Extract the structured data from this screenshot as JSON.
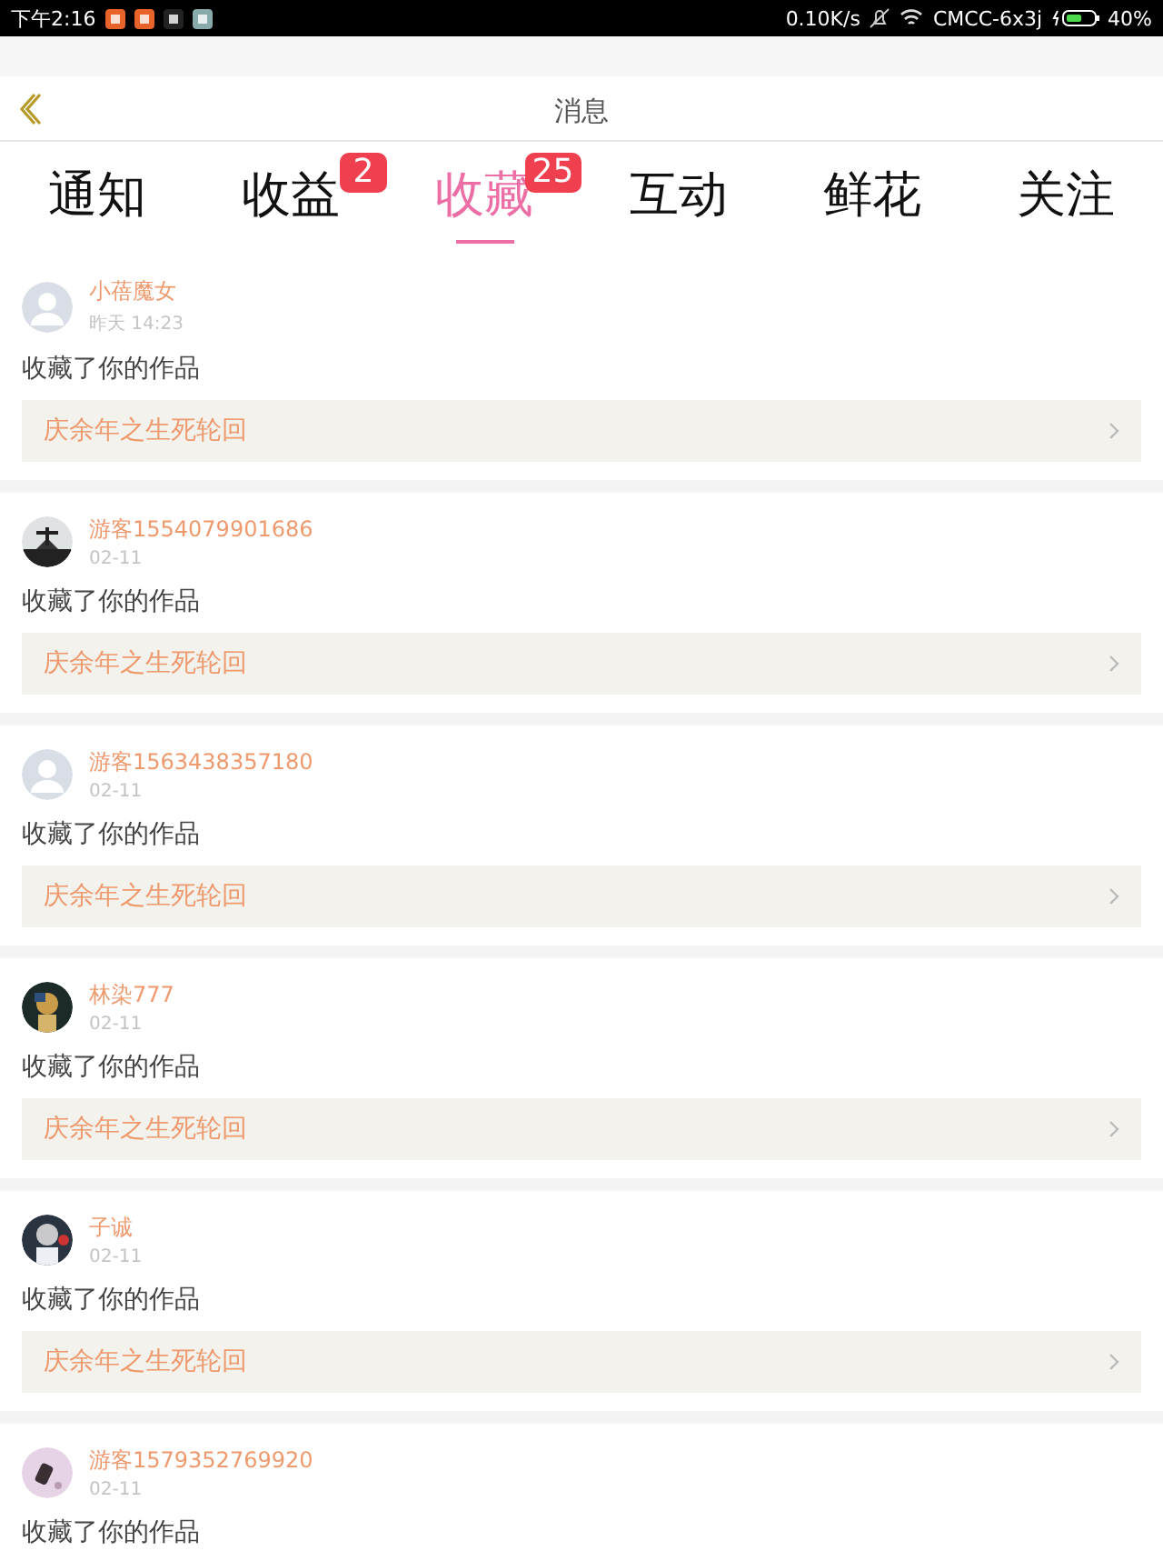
{
  "status_bar": {
    "time": "下午2:16",
    "speed": "0.10K/s",
    "carrier": "CMCC-6x3j",
    "battery": "40%"
  },
  "header": {
    "title": "消息"
  },
  "tabs": [
    {
      "label": "通知",
      "selected": false
    },
    {
      "label": "收益",
      "selected": false,
      "badge": "2"
    },
    {
      "label": "收藏",
      "selected": true,
      "badge": "25"
    },
    {
      "label": "互动",
      "selected": false
    },
    {
      "label": "鲜花",
      "selected": false
    },
    {
      "label": "关注",
      "selected": false
    }
  ],
  "messages": [
    {
      "user": "小蓓魔女",
      "time": "昨天 14:23",
      "kind": "default_avatar",
      "text": "收藏了你的作品",
      "work": "庆余年之生死轮回"
    },
    {
      "user": "游客1554079901686",
      "time": "02-11",
      "kind": "picture",
      "text": "收藏了你的作品",
      "work": "庆余年之生死轮回"
    },
    {
      "user": "游客1563438357180",
      "time": "02-11",
      "kind": "default_avatar",
      "text": "收藏了你的作品",
      "work": "庆余年之生死轮回"
    },
    {
      "user": "林染777",
      "time": "02-11",
      "kind": "picture",
      "text": "收藏了你的作品",
      "work": "庆余年之生死轮回"
    },
    {
      "user": "子诚",
      "time": "02-11",
      "kind": "picture",
      "text": "收藏了你的作品",
      "work": "庆余年之生死轮回"
    },
    {
      "user": "游客1579352769920",
      "time": "02-11",
      "kind": "picture",
      "text": "收藏了你的作品"
    }
  ]
}
